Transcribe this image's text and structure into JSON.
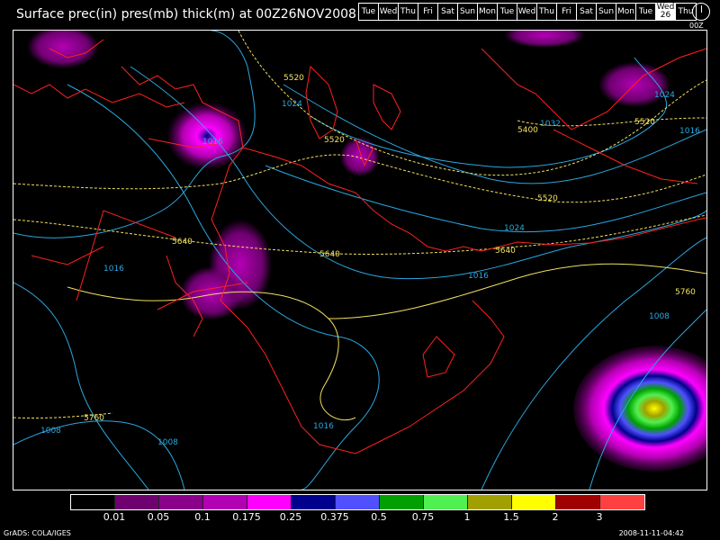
{
  "title": "Surface prec(in) pres(mb) thick(m) at 00Z26NOV2008",
  "days": [
    "Tue",
    "Wed",
    "Thu",
    "Fri",
    "Sat",
    "Sun",
    "Mon",
    "Tue",
    "Wed",
    "Thu",
    "Fri",
    "Sat",
    "Sun",
    "Mon",
    "Tue",
    "Wed",
    "Thu"
  ],
  "active_day": {
    "label": "Wed",
    "date": "26"
  },
  "clock_label": "00Z",
  "pressure_labels": [
    "1016",
    "1024",
    "1032",
    "1024",
    "1016",
    "1016",
    "1016",
    "1008",
    "1008",
    "1008",
    "1016",
    "1024"
  ],
  "thickness_labels": [
    "5520",
    "5520",
    "5400",
    "5520",
    "5520",
    "5640",
    "5640",
    "5640",
    "5760",
    "5760"
  ],
  "legend": {
    "colors": [
      "#000000",
      "#6e0070",
      "#8a008a",
      "#b400b4",
      "#ff00ff",
      "#00008c",
      "#5050ff",
      "#00a000",
      "#50f050",
      "#a0a000",
      "#ffff00",
      "#a00000",
      "#ff4040"
    ],
    "labels": [
      "0.01",
      "0.05",
      "0.1",
      "0.175",
      "0.25",
      "0.375",
      "0.5",
      "0.75",
      "1",
      "1.5",
      "2",
      "3"
    ]
  },
  "credit": "GrADS: COLA/IGES",
  "timestamp": "2008-11-11-04:42",
  "colors": {
    "coast": "#ff2020",
    "isobar": "#2aa7e0",
    "thickness": "#f0e060",
    "frame": "#ffffff"
  }
}
